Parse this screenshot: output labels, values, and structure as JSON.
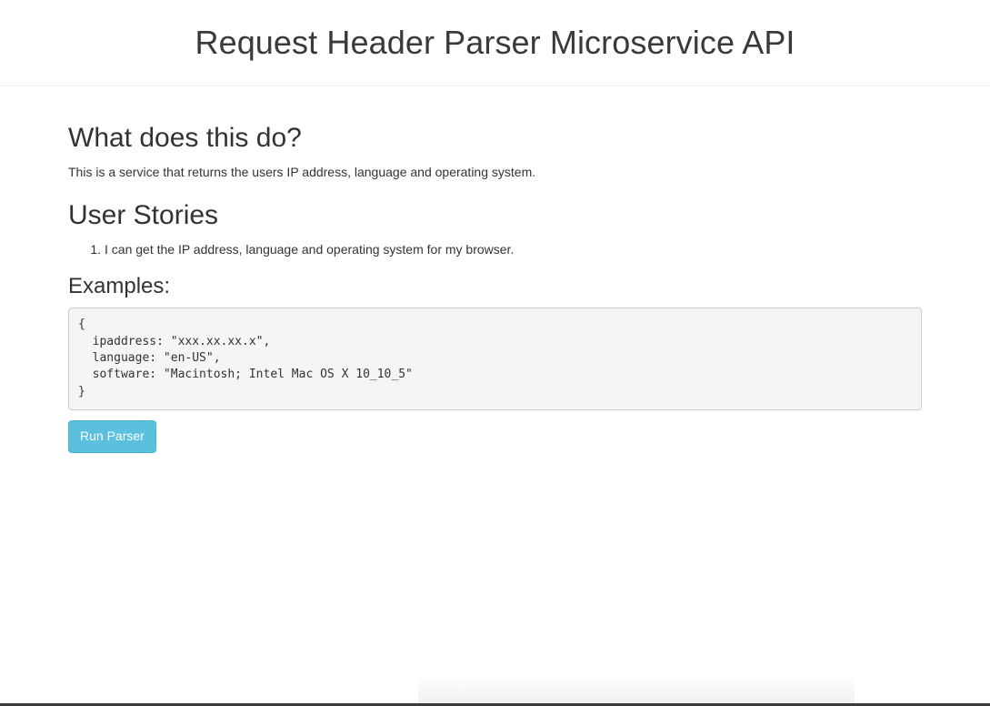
{
  "header": {
    "title": "Request Header Parser Microservice API"
  },
  "about": {
    "heading": "What does this do?",
    "description": "This is a service that returns the users IP address, language and operating system."
  },
  "stories": {
    "heading": "User Stories",
    "items": [
      "I can get the IP address, language and operating system for my browser."
    ]
  },
  "examples": {
    "heading": "Examples:",
    "code_lines": [
      "{",
      "  ipaddress: \"xxx.xx.xx.x\",",
      "  language: \"en-US\",",
      "  software: \"Macintosh; Intel Mac OS X 10_10_5\"",
      "}"
    ]
  },
  "actions": {
    "run_label": "Run Parser"
  },
  "colors": {
    "button_bg": "#5bc0de",
    "code_bg": "#f5f5f5",
    "text": "#333333"
  }
}
